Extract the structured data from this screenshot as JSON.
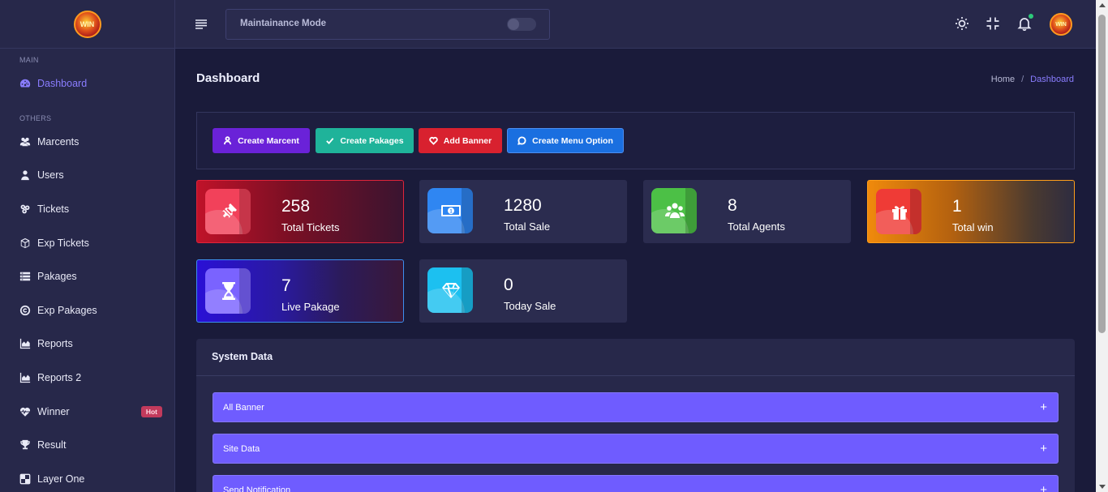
{
  "app": {
    "logo_text": "WIN"
  },
  "sidebar": {
    "sections": {
      "main": "MAIN",
      "others": "OTHERS"
    },
    "items": [
      {
        "label": "Dashboard",
        "icon": "dashboard-icon"
      },
      {
        "label": "Marcents",
        "icon": "users-group-icon"
      },
      {
        "label": "Users",
        "icon": "user-icon"
      },
      {
        "label": "Tickets",
        "icon": "tickets-icon"
      },
      {
        "label": "Exp Tickets",
        "icon": "box-icon"
      },
      {
        "label": "Pakages",
        "icon": "list-icon"
      },
      {
        "label": "Exp Pakages",
        "icon": "copyright-icon"
      },
      {
        "label": "Reports",
        "icon": "area-chart-icon"
      },
      {
        "label": "Reports 2",
        "icon": "area-chart-icon"
      },
      {
        "label": "Winner",
        "icon": "heartbeat-icon",
        "badge": "Hot"
      },
      {
        "label": "Result",
        "icon": "trophy-icon"
      },
      {
        "label": "Layer One",
        "icon": "layers-icon"
      }
    ]
  },
  "header": {
    "maintenance_label": "Maintainance Mode",
    "maintenance_on": false
  },
  "page": {
    "title": "Dashboard",
    "breadcrumb": {
      "home": "Home",
      "sep": "/",
      "current": "Dashboard"
    }
  },
  "actions": [
    {
      "label": "Create Marcent",
      "color": "#6a22d8",
      "icon": "user-icon"
    },
    {
      "label": "Create Pakages",
      "color": "#1fb39a",
      "icon": "check-icon"
    },
    {
      "label": "Add Banner",
      "color": "#d8212f",
      "icon": "heart-icon"
    },
    {
      "label": "Create Menu Option",
      "color": "#1a6fe0",
      "icon": "chat-icon"
    }
  ],
  "stats": [
    {
      "value": "258",
      "label": "Total Tickets",
      "icon": "ticket-icon"
    },
    {
      "value": "1280",
      "label": "Total Sale",
      "icon": "money-icon"
    },
    {
      "value": "8",
      "label": "Total Agents",
      "icon": "agents-icon"
    },
    {
      "value": "1",
      "label": "Total win",
      "icon": "gift-icon"
    },
    {
      "value": "7",
      "label": "Live Pakage",
      "icon": "hourglass-icon"
    },
    {
      "value": "0",
      "label": "Today Sale",
      "icon": "diamond-icon"
    }
  ],
  "system": {
    "title": "System Data",
    "panels": [
      {
        "label": "All Banner",
        "toggle": "+"
      },
      {
        "label": "Site Data",
        "toggle": "+"
      },
      {
        "label": "Send Notification",
        "toggle": "+"
      }
    ]
  }
}
